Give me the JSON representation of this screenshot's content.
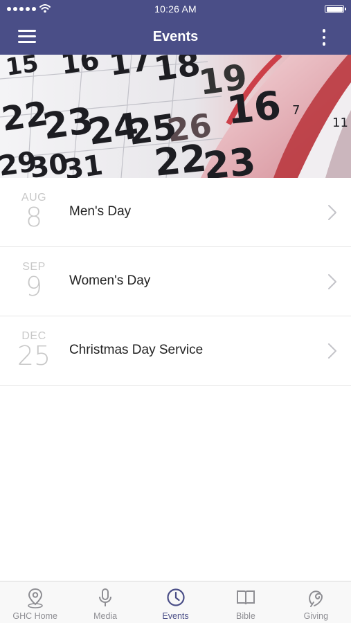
{
  "status_bar": {
    "time": "10:26 AM",
    "signal_icon": "signal-dots-icon",
    "wifi_icon": "wifi-icon",
    "battery_icon": "battery-icon"
  },
  "nav": {
    "title": "Events",
    "menu_icon": "hamburger-menu-icon",
    "more_icon": "more-vertical-icon"
  },
  "banner": {
    "description_icon": "calendar-pages-image",
    "numbers": [
      "15",
      "16",
      "17",
      "18",
      "19",
      "22",
      "23",
      "24",
      "25",
      "26",
      "29",
      "30",
      "31",
      "16",
      "7",
      "11",
      "22",
      "23"
    ]
  },
  "events": [
    {
      "month": "AUG",
      "day": "8",
      "title": "Men's Day"
    },
    {
      "month": "SEP",
      "day": "9",
      "title": "Women's Day"
    },
    {
      "month": "DEC",
      "day": "25",
      "title": "Christmas Day Service"
    }
  ],
  "tabs": [
    {
      "label": "GHC Home",
      "icon": "location-pin-icon",
      "active": false
    },
    {
      "label": "Media",
      "icon": "microphone-icon",
      "active": false
    },
    {
      "label": "Events",
      "icon": "clock-icon",
      "active": true
    },
    {
      "label": "Bible",
      "icon": "book-icon",
      "active": false
    },
    {
      "label": "Giving",
      "icon": "giving-icon",
      "active": false
    }
  ],
  "colors": {
    "brand": "#4a4e87",
    "tab_inactive": "#8e8e93",
    "date_text": "#c8c8c8"
  }
}
